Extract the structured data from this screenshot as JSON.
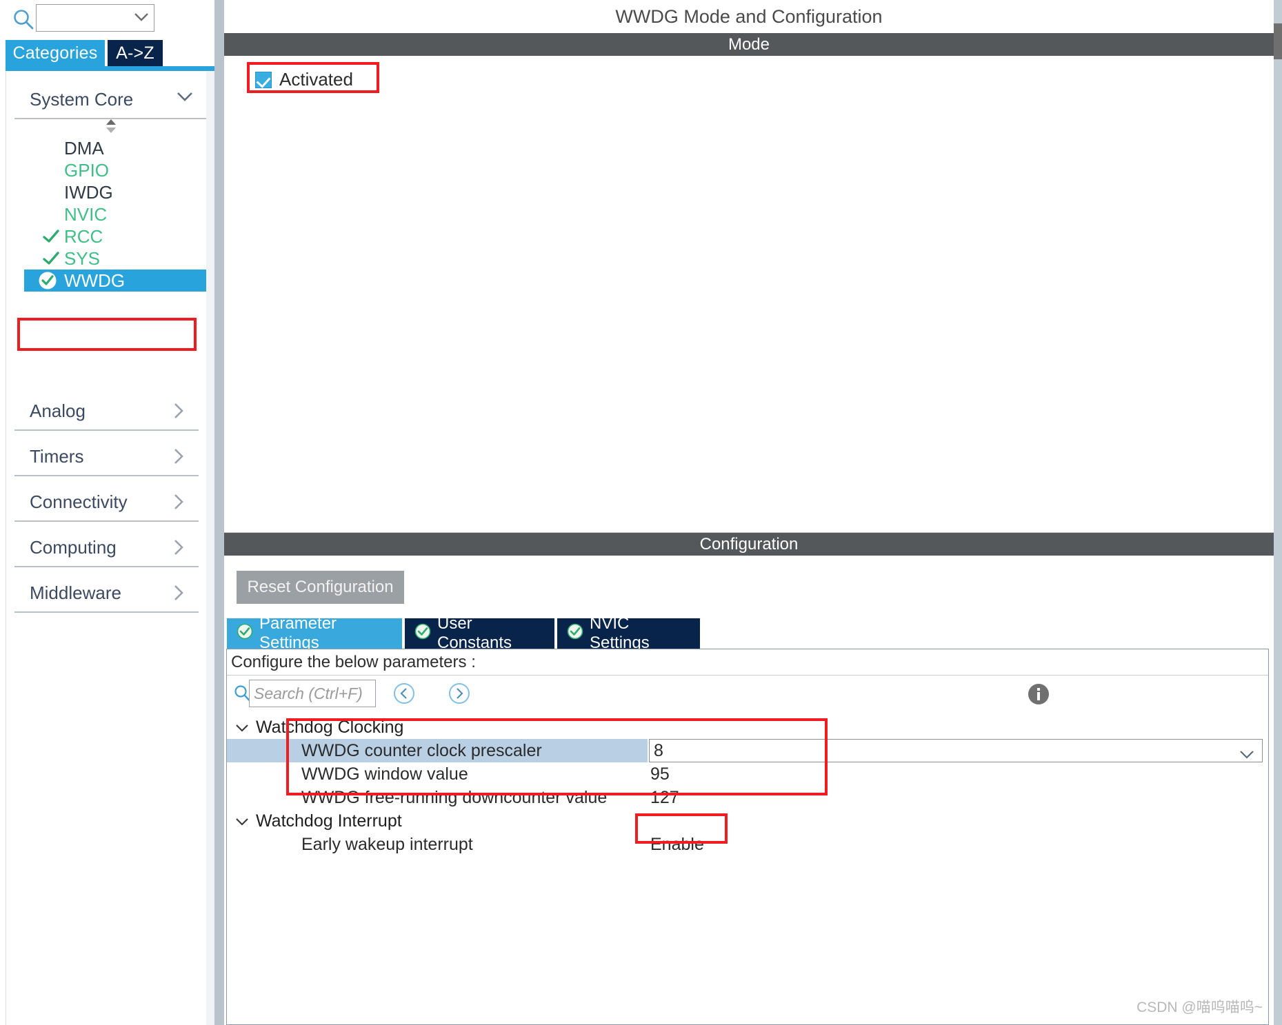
{
  "left_panel": {
    "search": {
      "value": "",
      "icon": "search-icon"
    },
    "gear_icon": "gear-icon",
    "tabs": [
      {
        "label": "Categories",
        "active": true
      },
      {
        "label": "A->Z",
        "active": false
      }
    ],
    "sections": [
      {
        "label": "System Core",
        "expanded": true
      },
      {
        "label": "Analog",
        "expanded": false
      },
      {
        "label": "Timers",
        "expanded": false
      },
      {
        "label": "Connectivity",
        "expanded": false
      },
      {
        "label": "Computing",
        "expanded": false
      },
      {
        "label": "Middleware",
        "expanded": false
      }
    ],
    "system_core_items": [
      {
        "label": "DMA",
        "state": "plain",
        "checked": false
      },
      {
        "label": "GPIO",
        "state": "green",
        "checked": false
      },
      {
        "label": "IWDG",
        "state": "plain",
        "checked": false
      },
      {
        "label": "NVIC",
        "state": "green",
        "checked": false
      },
      {
        "label": "RCC",
        "state": "green",
        "checked": true
      },
      {
        "label": "SYS",
        "state": "green",
        "checked": true
      },
      {
        "label": "WWDG",
        "state": "selected",
        "checked": true
      }
    ]
  },
  "main": {
    "title": "WWDG Mode and Configuration",
    "mode_band": "Mode",
    "activated_label": "Activated",
    "activated_checked": true,
    "config_band": "Configuration",
    "reset_button": "Reset Configuration",
    "tabs": [
      {
        "label": "Parameter Settings",
        "active": true
      },
      {
        "label": "User Constants",
        "active": false
      },
      {
        "label": "NVIC Settings",
        "active": false
      }
    ],
    "hint": "Configure the below parameters :",
    "search_placeholder": "Search (Ctrl+F)",
    "search_value": "",
    "prev_icon": "prev-circle-icon",
    "next_icon": "next-circle-icon",
    "info_icon": "info-icon",
    "groups": [
      {
        "label": "Watchdog Clocking",
        "expanded": true,
        "rows": [
          {
            "name": "WWDG counter clock prescaler",
            "value": "8",
            "selected": true,
            "editor": "combo"
          },
          {
            "name": "WWDG window value",
            "value": "95",
            "selected": false,
            "editor": "text"
          },
          {
            "name": "WWDG free-running downcounter value",
            "value": "127",
            "selected": false,
            "editor": "text"
          }
        ]
      },
      {
        "label": "Watchdog Interrupt",
        "expanded": true,
        "rows": [
          {
            "name": "Early wakeup interrupt",
            "value": "Enable",
            "selected": false,
            "editor": "text"
          }
        ]
      }
    ]
  },
  "annotations": {
    "accent_red": "#ef1d22",
    "accent_blue": "#29a3dc",
    "accent_navy": "#08244a",
    "band_gray": "#55585a"
  },
  "watermark": "CSDN @喵呜喵呜~"
}
